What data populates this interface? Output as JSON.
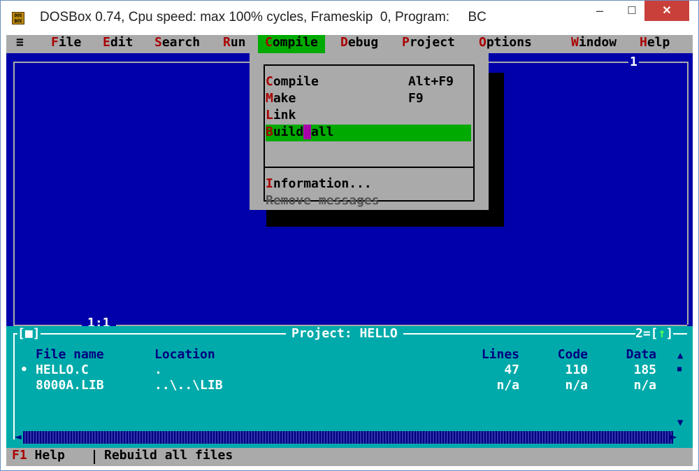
{
  "window": {
    "title": "DOSBox 0.74, Cpu speed: max 100% cycles, Frameskip  0, Program:     BC",
    "icon_label": "DOS BOX",
    "minimize": "–",
    "maximize": "☐",
    "close": "✕"
  },
  "menubar": {
    "system": "≡",
    "items": [
      {
        "hot": "F",
        "rest": "ile"
      },
      {
        "hot": "E",
        "rest": "dit"
      },
      {
        "hot": "S",
        "rest": "earch"
      },
      {
        "hot": "R",
        "rest": "un"
      },
      {
        "hot": "C",
        "rest": "ompile"
      },
      {
        "hot": "D",
        "rest": "ebug"
      },
      {
        "hot": "P",
        "rest": "roject"
      },
      {
        "hot": "O",
        "rest": "ptions"
      },
      {
        "hot": "W",
        "rest": "indow"
      },
      {
        "hot": "H",
        "rest": "elp"
      }
    ]
  },
  "editor": {
    "window_number": "1",
    "cursor_position": "1:1"
  },
  "compile_menu": {
    "items": [
      {
        "hot": "C",
        "rest": "ompile",
        "accel": "Alt+F9"
      },
      {
        "hot": "M",
        "rest": "ake",
        "accel": "F9"
      },
      {
        "hot": "L",
        "rest": "ink",
        "accel": ""
      },
      {
        "hot": "B",
        "rest": "uild",
        "tail": "all",
        "accel": ""
      },
      {
        "hot": "I",
        "rest": "nformation...",
        "accel": ""
      },
      {
        "text": "Remove messages",
        "accel": ""
      }
    ],
    "selected": "Build all"
  },
  "project": {
    "title": "Project: HELLO",
    "close_box": "[■]",
    "window_number": "2=[",
    "zoom_icon": "↑",
    "zoom_close": "]",
    "headers": {
      "file": "File name",
      "location": "Location",
      "lines": "Lines",
      "code": "Code",
      "data": "Data"
    },
    "rows": [
      {
        "marker": "•",
        "file": "HELLO.C",
        "location": ".",
        "lines": "47",
        "code": "110",
        "data": "185"
      },
      {
        "marker": "",
        "file": "8000A.LIB",
        "location": "..\\..\\LIB",
        "lines": "n/a",
        "code": "n/a",
        "data": "n/a"
      }
    ]
  },
  "statusbar": {
    "key": "F1",
    "key_label": "Help",
    "message": "Rebuild all files"
  },
  "colors": {
    "dos_blue": "#0000aa",
    "dos_gray": "#aaaaaa",
    "dos_green": "#00aa00",
    "dos_cyan": "#00aaaa",
    "hotkey_red": "#aa0000",
    "close_red": "#c9403a"
  }
}
